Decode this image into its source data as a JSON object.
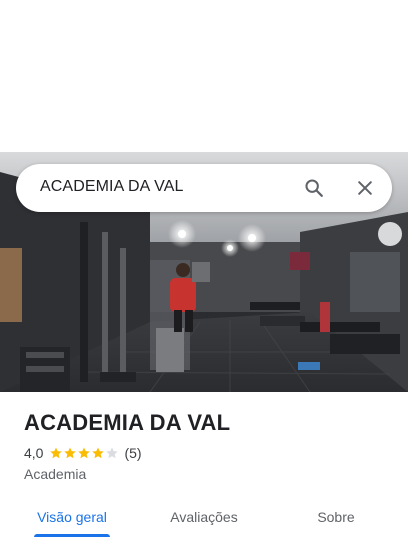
{
  "search": {
    "query": "ACADEMIA DA VAL",
    "search_icon": "search-icon",
    "close_icon": "close-icon"
  },
  "place": {
    "name": "ACADEMIA DA VAL",
    "rating": "4,0",
    "rating_value": 4.0,
    "rating_max": 5,
    "reviews": "(5)",
    "category": "Academia",
    "star_color": "#fbbc04",
    "star_empty_color": "#dadce0"
  },
  "tabs": [
    {
      "label": "Visão geral",
      "active": true
    },
    {
      "label": "Avaliações",
      "active": false
    },
    {
      "label": "Sobre",
      "active": false
    }
  ],
  "colors": {
    "accent": "#1a73e8"
  }
}
